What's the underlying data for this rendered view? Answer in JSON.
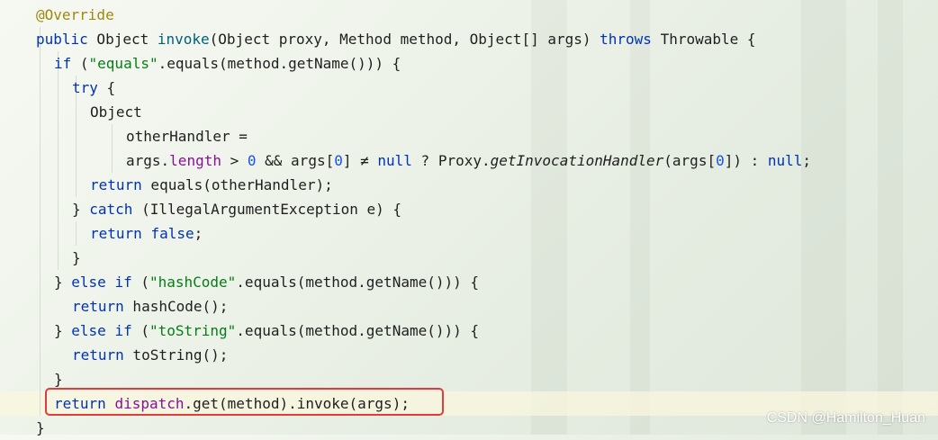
{
  "code": {
    "annotation": "@Override",
    "l2": {
      "kw_public": "public",
      "t1": " Object ",
      "method": "invoke",
      "t2": "(Object proxy, Method method, Object[] args) ",
      "kw_throws": "throws",
      "t3": " Throwable {"
    },
    "l3": {
      "kw_if": "if",
      "t1": " (",
      "str": "\"equals\"",
      "t2": ".equals(method.getName())) {"
    },
    "l4": {
      "kw_try": "try",
      "t1": " {"
    },
    "l5": {
      "t1": "Object"
    },
    "l6": {
      "t1": "otherHandler ="
    },
    "l7": {
      "t1": "args.",
      "fld": "length",
      "t2": " > ",
      "num0": "0",
      "t3": " && args[",
      "num1": "0",
      "t4": "] ≠ ",
      "kw_null1": "null",
      "t5": " ? Proxy.",
      "call": "getInvocationHandler",
      "t6": "(args[",
      "num2": "0",
      "t7": "]) : ",
      "kw_null2": "null",
      "t8": ";"
    },
    "l8": {
      "kw_return": "return",
      "t1": " equals(otherHandler);"
    },
    "l9": {
      "t1": "} ",
      "kw_catch": "catch",
      "t2": " (IllegalArgumentException e) {"
    },
    "l10": {
      "kw_return": "return",
      "t1": " ",
      "kw_false": "false",
      "t2": ";"
    },
    "l11": {
      "t1": "}"
    },
    "l12": {
      "t1": "} ",
      "kw_else": "else",
      "t2": " ",
      "kw_if": "if",
      "t3": " (",
      "str": "\"hashCode\"",
      "t4": ".equals(method.getName())) {"
    },
    "l13": {
      "kw_return": "return",
      "t1": " hashCode();"
    },
    "l14": {
      "t1": "} ",
      "kw_else": "else",
      "t2": " ",
      "kw_if": "if",
      "t3": " (",
      "str": "\"toString\"",
      "t4": ".equals(method.getName())) {"
    },
    "l15": {
      "kw_return": "return",
      "t1": " toString();"
    },
    "l16": {
      "t1": "}"
    },
    "l17": {
      "kw_return": "return",
      "t1": " ",
      "fld": "dispatch",
      "t2": ".get(method).invoke(args);"
    },
    "l18": {
      "t1": "}"
    }
  },
  "colors": {
    "keyword": "#0033b3",
    "string": "#067d17",
    "number": "#1750eb",
    "annotation": "#9e880d",
    "field": "#871094",
    "highlight_box": "#e03c3c"
  },
  "watermark": "CSDN @Hamilton_Huan"
}
